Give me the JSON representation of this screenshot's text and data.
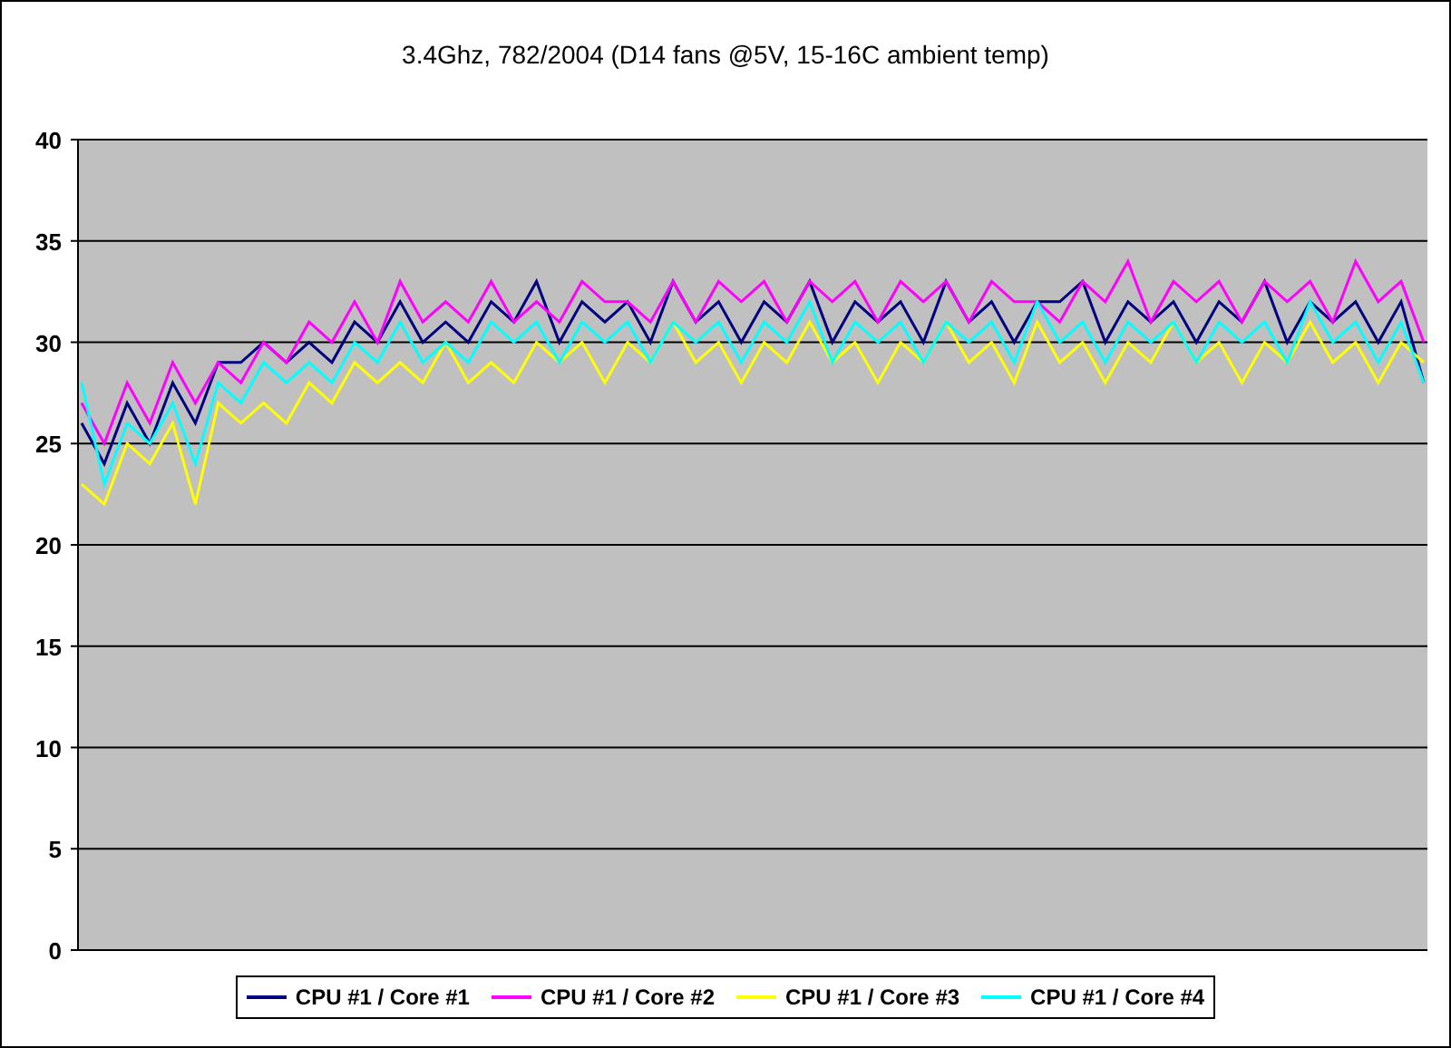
{
  "title": "3.4Ghz, 782/2004 (D14 fans @5V, 15-16C ambient temp)",
  "chart_data": {
    "type": "line",
    "grid": true,
    "ylim": [
      0,
      40
    ],
    "yticks": [
      0,
      5,
      10,
      15,
      20,
      25,
      30,
      35,
      40
    ],
    "series": [
      {
        "name": "CPU #1 / Core #1",
        "color": "#000080",
        "values": [
          26,
          24,
          27,
          25,
          28,
          26,
          29,
          29,
          30,
          29,
          30,
          29,
          31,
          30,
          32,
          30,
          31,
          30,
          32,
          31,
          33,
          30,
          32,
          31,
          32,
          30,
          33,
          31,
          32,
          30,
          32,
          31,
          33,
          30,
          32,
          31,
          32,
          30,
          33,
          31,
          32,
          30,
          32,
          32,
          33,
          30,
          32,
          31,
          32,
          30,
          32,
          31,
          33,
          30,
          32,
          31,
          32,
          30,
          32,
          28
        ]
      },
      {
        "name": "CPU #1 / Core #2",
        "color": "#ff00ff",
        "values": [
          27,
          25,
          28,
          26,
          29,
          27,
          29,
          28,
          30,
          29,
          31,
          30,
          32,
          30,
          33,
          31,
          32,
          31,
          33,
          31,
          32,
          31,
          33,
          32,
          32,
          31,
          33,
          31,
          33,
          32,
          33,
          31,
          33,
          32,
          33,
          31,
          33,
          32,
          33,
          31,
          33,
          32,
          32,
          31,
          33,
          32,
          34,
          31,
          33,
          32,
          33,
          31,
          33,
          32,
          33,
          31,
          34,
          32,
          33,
          30
        ]
      },
      {
        "name": "CPU #1 / Core #3",
        "color": "#ffff00",
        "values": [
          23,
          22,
          25,
          24,
          26,
          22,
          27,
          26,
          27,
          26,
          28,
          27,
          29,
          28,
          29,
          28,
          30,
          28,
          29,
          28,
          30,
          29,
          30,
          28,
          30,
          29,
          31,
          29,
          30,
          28,
          30,
          29,
          31,
          29,
          30,
          28,
          30,
          29,
          31,
          29,
          30,
          28,
          31,
          29,
          30,
          28,
          30,
          29,
          31,
          29,
          30,
          28,
          30,
          29,
          31,
          29,
          30,
          28,
          30,
          29
        ]
      },
      {
        "name": "CPU #1 / Core #4",
        "color": "#00ffff",
        "values": [
          28,
          23,
          26,
          25,
          27,
          24,
          28,
          27,
          29,
          28,
          29,
          28,
          30,
          29,
          31,
          29,
          30,
          29,
          31,
          30,
          31,
          29,
          31,
          30,
          31,
          29,
          31,
          30,
          31,
          29,
          31,
          30,
          32,
          29,
          31,
          30,
          31,
          29,
          31,
          30,
          31,
          29,
          32,
          30,
          31,
          29,
          31,
          30,
          31,
          29,
          31,
          30,
          31,
          29,
          32,
          30,
          31,
          29,
          31,
          28
        ]
      }
    ]
  }
}
